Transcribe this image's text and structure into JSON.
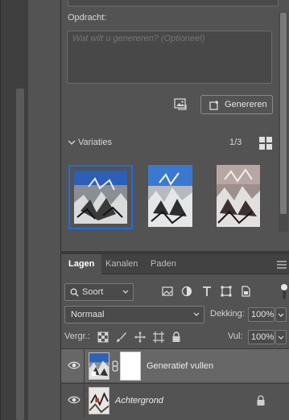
{
  "colors": {
    "panel_bg": "#535353",
    "dark_bg": "#3f3f3f",
    "selection_border": "#1e6ce0",
    "selected_layer_bg": "#676767"
  },
  "generate": {
    "label": "Opdracht:",
    "prompt_placeholder": "Wat wilt u genereren? (Optioneel)",
    "prompt_value": "",
    "reference_image_icon": "image-icon",
    "generate_label": "Genereren",
    "variations_label": "Variaties",
    "variations_counter": "1/3",
    "grid_icon": "grid-view-icon",
    "variations": [
      {
        "name": "variation-1",
        "selected": true
      },
      {
        "name": "variation-2",
        "selected": false
      },
      {
        "name": "variation-3",
        "selected": false
      }
    ]
  },
  "layers_panel": {
    "tabs": [
      {
        "label": "Lagen",
        "active": true
      },
      {
        "label": "Kanalen",
        "active": false
      },
      {
        "label": "Paden",
        "active": false
      }
    ],
    "filter_label": "Soort",
    "blend_mode": "Normaal",
    "opacity_label": "Dekking:",
    "opacity_value": "100%",
    "lock_label": "Vergr.:",
    "fill_label": "Vul:",
    "fill_value": "100%",
    "layers": [
      {
        "name": "Generatief vullen",
        "visible": true,
        "selected": true,
        "has_mask": true,
        "locked": false
      },
      {
        "name": "Achtergrond",
        "visible": true,
        "selected": false,
        "has_mask": false,
        "locked": true
      }
    ]
  }
}
